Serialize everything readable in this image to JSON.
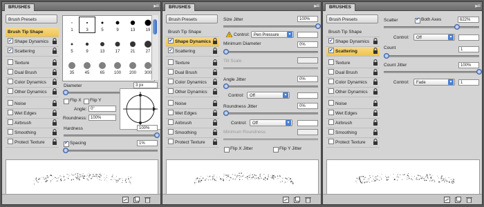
{
  "panels": [
    {
      "title": "BRUSHES",
      "preset_label": "Brush Presets",
      "options": [
        {
          "label": "Brush Tip Shape",
          "checked": false,
          "selected": true,
          "lock": false
        },
        {
          "label": "Shape Dynamics",
          "checked": true,
          "selected": false,
          "lock": true
        },
        {
          "label": "Scattering",
          "checked": true,
          "selected": false,
          "lock": true
        },
        {
          "label": "Texture",
          "checked": false,
          "selected": false,
          "lock": true
        },
        {
          "label": "Dual Brush",
          "checked": false,
          "selected": false,
          "lock": true
        },
        {
          "label": "Color Dynamics",
          "checked": false,
          "selected": false,
          "lock": true
        },
        {
          "label": "Other Dynamics",
          "checked": false,
          "selected": false,
          "lock": true
        },
        {
          "label": "Noise",
          "checked": false,
          "selected": false,
          "lock": true
        },
        {
          "label": "Wet Edges",
          "checked": false,
          "selected": false,
          "lock": true
        },
        {
          "label": "Airbrush",
          "checked": false,
          "selected": false,
          "lock": true
        },
        {
          "label": "Smoothing",
          "checked": false,
          "selected": false,
          "lock": true
        },
        {
          "label": "Protect Texture",
          "checked": false,
          "selected": false,
          "lock": true
        }
      ],
      "brush_sizes": [
        "1",
        "3",
        "5",
        "9",
        "13",
        "19",
        "5",
        "9",
        "13",
        "17",
        "21",
        "27",
        "35",
        "45",
        "65",
        "100",
        "200",
        "300"
      ],
      "diameter_label": "Diameter",
      "diameter_value": "3 px",
      "flip_x": "Flip X",
      "flip_y": "Flip Y",
      "angle_label": "Angle:",
      "angle_value": "0°",
      "roundness_label": "Roundness:",
      "roundness_value": "100%",
      "hardness_label": "Hardness",
      "hardness_value": "100%",
      "spacing_label": "Spacing",
      "spacing_value": "1%"
    },
    {
      "title": "BRUSHES",
      "preset_label": "Brush Presets",
      "options": [
        {
          "label": "Brush Tip Shape",
          "checked": false,
          "selected": false,
          "lock": false
        },
        {
          "label": "Shape Dynamics",
          "checked": true,
          "selected": true,
          "lock": true
        },
        {
          "label": "Scattering",
          "checked": true,
          "selected": false,
          "lock": true
        },
        {
          "label": "Texture",
          "checked": false,
          "selected": false,
          "lock": true
        },
        {
          "label": "Dual Brush",
          "checked": false,
          "selected": false,
          "lock": true
        },
        {
          "label": "Color Dynamics",
          "checked": false,
          "selected": false,
          "lock": true
        },
        {
          "label": "Other Dynamics",
          "checked": false,
          "selected": false,
          "lock": true
        },
        {
          "label": "Noise",
          "checked": false,
          "selected": false,
          "lock": true
        },
        {
          "label": "Wet Edges",
          "checked": false,
          "selected": false,
          "lock": true
        },
        {
          "label": "Airbrush",
          "checked": false,
          "selected": false,
          "lock": true
        },
        {
          "label": "Smoothing",
          "checked": false,
          "selected": false,
          "lock": true
        },
        {
          "label": "Protect Texture",
          "checked": false,
          "selected": false,
          "lock": true
        }
      ],
      "size_jitter_label": "Size Jitter",
      "size_jitter_value": "100%",
      "control_label": "Control:",
      "control_pen": "Pen Pressure",
      "min_diameter_label": "Minimum Diameter",
      "min_diameter_value": "0%",
      "tilt_scale_label": "Tilt Scale",
      "angle_jitter_label": "Angle Jitter",
      "angle_jitter_value": "0%",
      "control_off": "Off",
      "roundness_jitter_label": "Roundness Jitter",
      "roundness_jitter_value": "0%",
      "min_roundness_label": "Minimum Roundness",
      "flip_x_jitter": "Flip X Jitter",
      "flip_y_jitter": "Flip Y Jitter"
    },
    {
      "title": "BRUSHES",
      "preset_label": "Brush Presets",
      "options": [
        {
          "label": "Brush Tip Shape",
          "checked": false,
          "selected": false,
          "lock": false
        },
        {
          "label": "Shape Dynamics",
          "checked": true,
          "selected": false,
          "lock": true
        },
        {
          "label": "Scattering",
          "checked": true,
          "selected": true,
          "lock": true
        },
        {
          "label": "Texture",
          "checked": false,
          "selected": false,
          "lock": true
        },
        {
          "label": "Dual Brush",
          "checked": false,
          "selected": false,
          "lock": true
        },
        {
          "label": "Color Dynamics",
          "checked": false,
          "selected": false,
          "lock": true
        },
        {
          "label": "Other Dynamics",
          "checked": false,
          "selected": false,
          "lock": true
        },
        {
          "label": "Noise",
          "checked": false,
          "selected": false,
          "lock": true
        },
        {
          "label": "Wet Edges",
          "checked": false,
          "selected": false,
          "lock": true
        },
        {
          "label": "Airbrush",
          "checked": false,
          "selected": false,
          "lock": true
        },
        {
          "label": "Smoothing",
          "checked": false,
          "selected": false,
          "lock": true
        },
        {
          "label": "Protect Texture",
          "checked": false,
          "selected": false,
          "lock": true
        }
      ],
      "scatter_label": "Scatter",
      "both_axes_label": "Both Axes",
      "scatter_value": "622%",
      "control_label": "Control:",
      "control_off": "Off",
      "count_label": "Count",
      "count_value": "1",
      "count_jitter_label": "Count Jitter",
      "count_jitter_value": "100%",
      "control_fade": "Fade",
      "fade_value": "1"
    }
  ],
  "colors": {
    "selected_item": "#f0c44a",
    "slider_knob": "#5c86d0",
    "panel_bg": "#d4d4d4"
  }
}
